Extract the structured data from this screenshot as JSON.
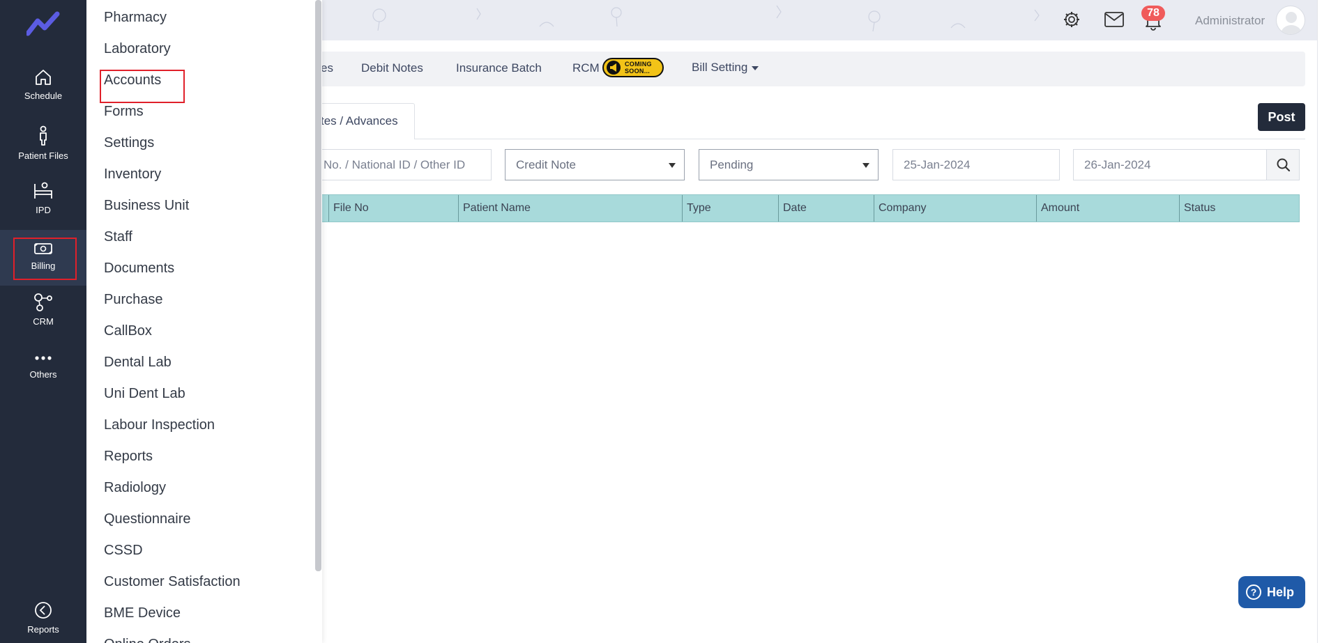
{
  "sidebar": {
    "items": [
      {
        "label": "Schedule",
        "icon": "home-icon"
      },
      {
        "label": "Patient Files",
        "icon": "person-icon"
      },
      {
        "label": "IPD",
        "icon": "bed-icon"
      },
      {
        "label": "Billing",
        "icon": "cash-icon"
      },
      {
        "label": "CRM",
        "icon": "network-icon"
      },
      {
        "label": "Others",
        "icon": "more-dots-icon"
      },
      {
        "label": "Reports",
        "icon": "gauge-icon"
      }
    ]
  },
  "header": {
    "notification_count": "78",
    "user_name": "Administrator"
  },
  "dropdown_menu": {
    "items": [
      "Pharmacy",
      "Laboratory",
      "Accounts",
      "Forms",
      "Settings",
      "Inventory",
      "Business Unit",
      "Staff",
      "Documents",
      "Purchase",
      "CallBox",
      "Dental Lab",
      "Uni Dent Lab",
      "Labour Inspection",
      "Reports",
      "Radiology",
      "Questionnaire",
      "CSSD",
      "Customer Satisfaction",
      "BME Device",
      "Online Orders"
    ]
  },
  "subtabs": {
    "partial_tab": "es",
    "debit_notes": "Debit Notes",
    "insurance_batch": "Insurance Batch",
    "rcm": "RCM",
    "coming_soon_line1": "COMING",
    "coming_soon_line2": "SOON...",
    "bill_setting": "Bill Setting"
  },
  "tabs": {
    "active": "tes / Advances"
  },
  "toolbar": {
    "post_label": "Post"
  },
  "filters": {
    "id_placeholder": "No. / National ID / Other ID",
    "note_type": "Credit Note",
    "status": "Pending",
    "date_from": "25-Jan-2024",
    "date_to": "26-Jan-2024"
  },
  "table": {
    "columns": [
      "File No",
      "Patient Name",
      "Type",
      "Date",
      "Company",
      "Amount",
      "Status"
    ]
  },
  "help": {
    "label": "Help"
  },
  "colors": {
    "sidebar_bg": "#232b3b",
    "table_header_bg": "#a8dadb",
    "highlight_red": "#e0202a",
    "help_blue": "#1f5aa8",
    "badge_red": "#f05b5b"
  }
}
